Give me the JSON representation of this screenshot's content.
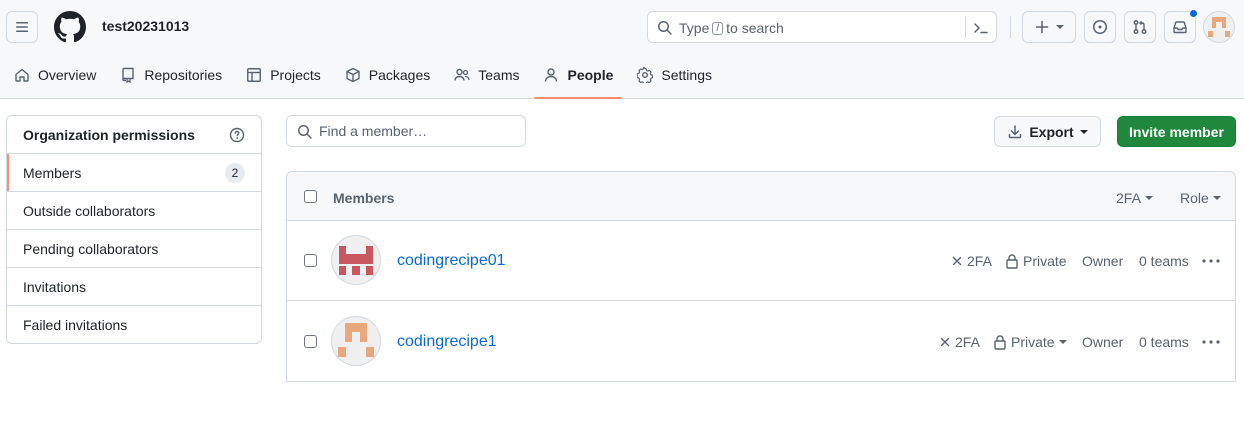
{
  "header": {
    "org_name": "test20231013",
    "search": {
      "prefix": "Type",
      "key": "/",
      "suffix": "to search"
    }
  },
  "tabs": [
    {
      "label": "Overview",
      "icon": "home-icon"
    },
    {
      "label": "Repositories",
      "icon": "repo-icon"
    },
    {
      "label": "Projects",
      "icon": "table-icon"
    },
    {
      "label": "Packages",
      "icon": "package-icon"
    },
    {
      "label": "Teams",
      "icon": "people-icon"
    },
    {
      "label": "People",
      "icon": "person-icon",
      "active": true
    },
    {
      "label": "Settings",
      "icon": "gear-icon"
    }
  ],
  "sidebar": {
    "title": "Organization permissions",
    "items": [
      {
        "label": "Members",
        "count": "2",
        "selected": true
      },
      {
        "label": "Outside collaborators"
      },
      {
        "label": "Pending collaborators"
      },
      {
        "label": "Invitations"
      },
      {
        "label": "Failed invitations"
      }
    ]
  },
  "toolbar": {
    "search_placeholder": "Find a member…",
    "export_label": "Export",
    "invite_label": "Invite member"
  },
  "table": {
    "header_title": "Members",
    "filter_2fa": "2FA",
    "filter_role": "Role"
  },
  "members": [
    {
      "username": "codingrecipe01",
      "twofa": "2FA",
      "visibility": "Private",
      "role": "Owner",
      "teams": "0 teams",
      "avatar_color": "#c9575f"
    },
    {
      "username": "codingrecipe1",
      "twofa": "2FA",
      "visibility": "Private",
      "role": "Owner",
      "teams": "0 teams",
      "avatar_color": "#e9a77d"
    }
  ],
  "colors": {
    "accent_tab": "#fd8c73",
    "link": "#0969da",
    "primary_button": "#1f883d"
  }
}
